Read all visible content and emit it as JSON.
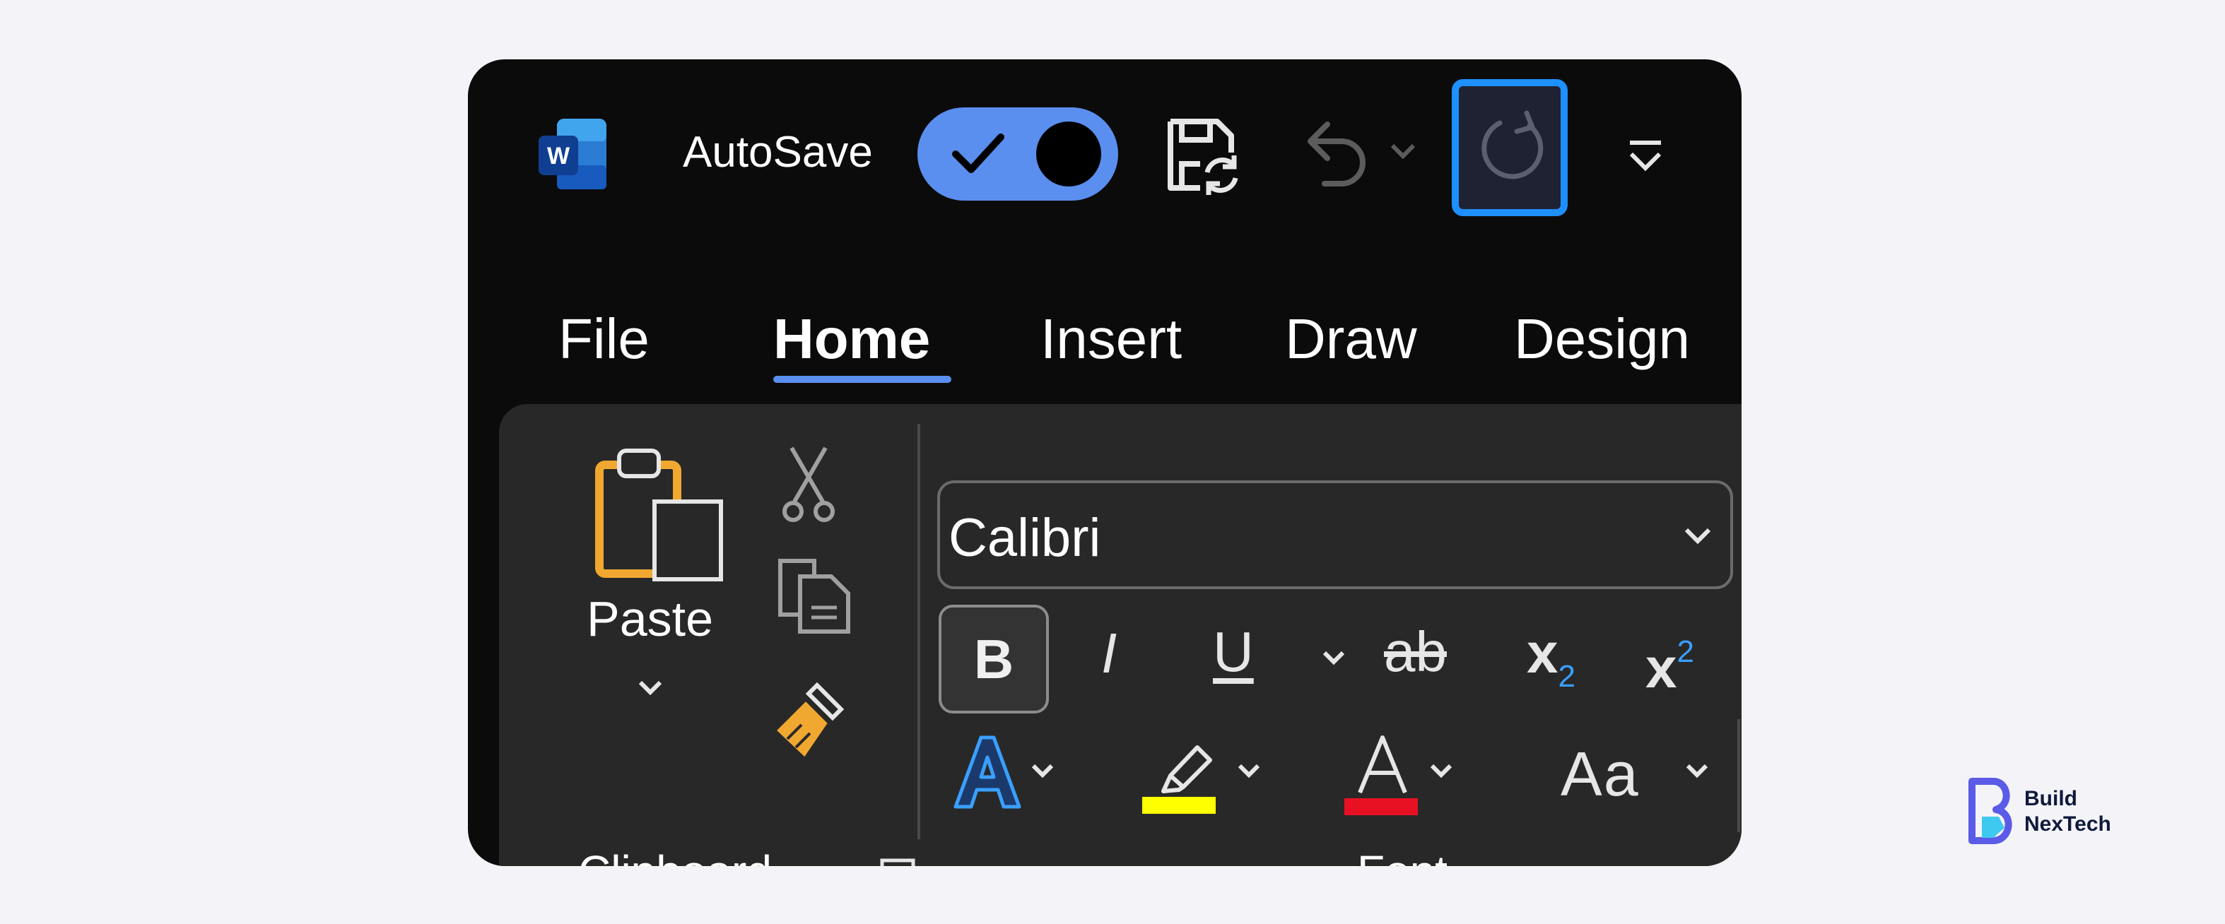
{
  "qat": {
    "autosave_label": "AutoSave",
    "autosave_state": "on"
  },
  "tabs": [
    {
      "label": "File"
    },
    {
      "label": "Home"
    },
    {
      "label": "Insert"
    },
    {
      "label": "Draw"
    },
    {
      "label": "Design"
    }
  ],
  "active_tab": "Home",
  "clipboard": {
    "paste_label": "Paste",
    "group_label": "Clipboard"
  },
  "font": {
    "font_name": "Calibri",
    "bold_label": "B",
    "italic_label": "I",
    "underline_label": "U",
    "strike_label": "ab",
    "subscript_base": "x",
    "subscript_digit": "2",
    "superscript_base": "x",
    "superscript_digit": "2",
    "case_label": "Aa",
    "group_label": "Font"
  },
  "colors": {
    "accent": "#5a8ff0",
    "redo_focus_border": "#1e90ff",
    "highlight_color": "#ffff00",
    "font_color": "#e81123",
    "paste_clipboard": "#f0a830"
  },
  "watermark": {
    "line1": "Build",
    "line2": "NexTech"
  }
}
